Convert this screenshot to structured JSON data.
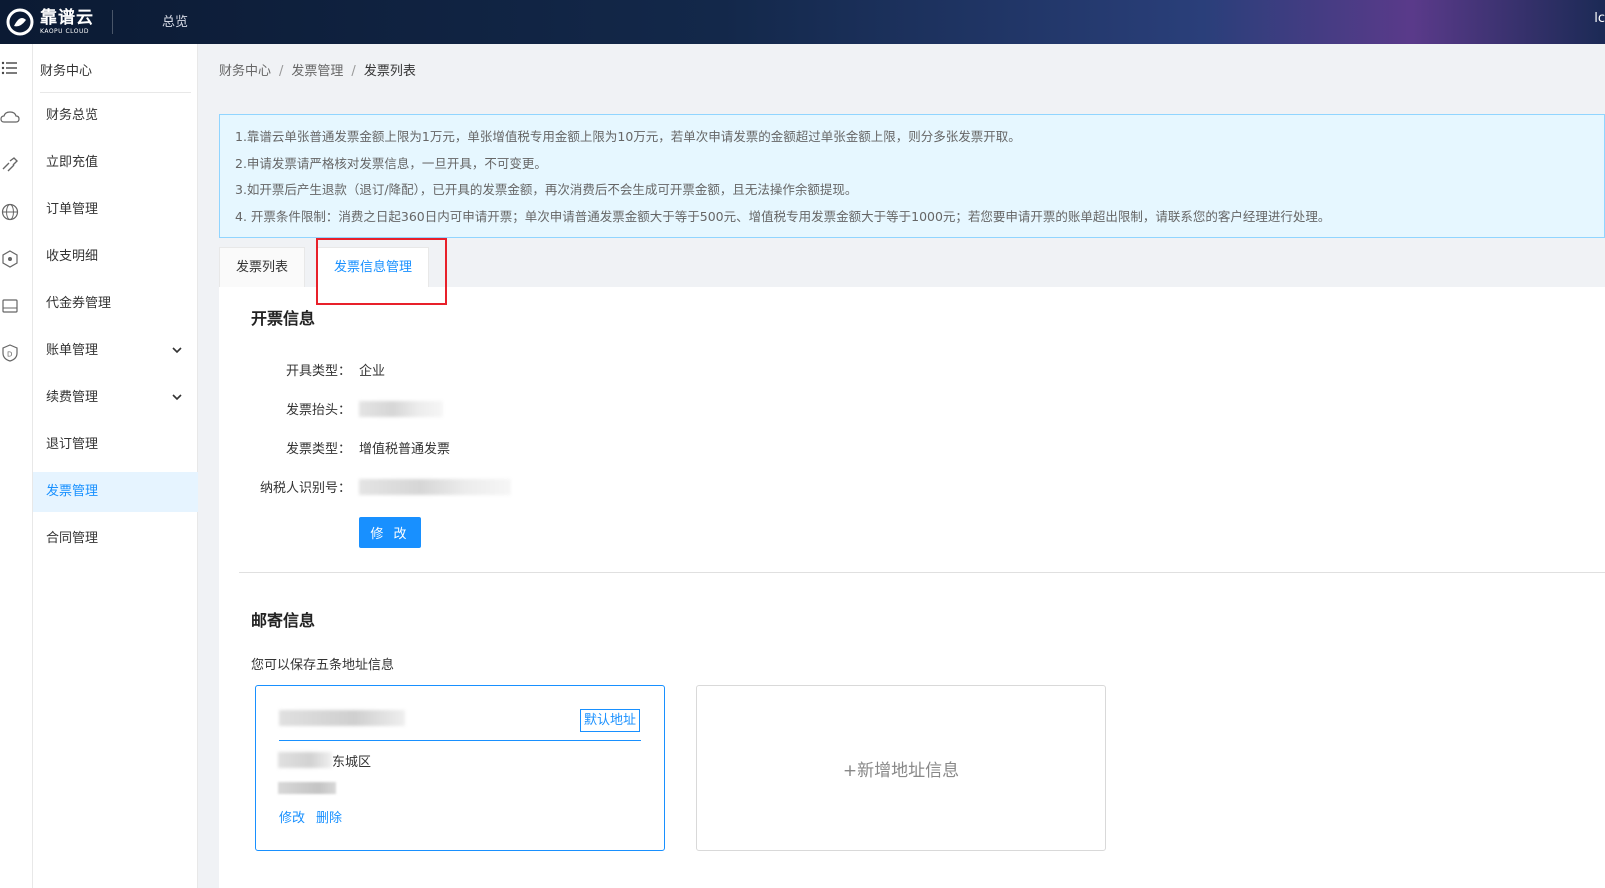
{
  "header": {
    "logo_cn": "靠谱云",
    "logo_en": "KAOPU CLOUD",
    "nav_overview": "总览",
    "right_text": "lc"
  },
  "sidebar": {
    "title": "财务中心",
    "items": [
      {
        "label": "财务总览"
      },
      {
        "label": "立即充值"
      },
      {
        "label": "订单管理"
      },
      {
        "label": "收支明细"
      },
      {
        "label": "代金券管理"
      },
      {
        "label": "账单管理",
        "expandable": true
      },
      {
        "label": "续费管理",
        "expandable": true
      },
      {
        "label": "退订管理"
      },
      {
        "label": "发票管理",
        "active": true
      },
      {
        "label": "合同管理"
      }
    ]
  },
  "breadcrumb": [
    "财务中心",
    "发票管理",
    "发票列表"
  ],
  "notice": [
    "1.靠谱云单张普通发票金额上限为1万元，单张增值税专用金额上限为10万元，若单次申请发票的金额超过单张金额上限，则分多张发票开取。",
    "2.申请发票请严格核对发票信息，一旦开具，不可变更。",
    "3.如开票后产生退款（退订/降配），已开具的发票金额，再次消费后不会生成可开票金额，且无法操作余额提现。",
    "4. 开票条件限制：消费之日起360日内可申请开票；单次申请普通发票金额大于等于500元、增值税专用发票金额大于等于1000元；若您要申请开票的账单超出限制，请联系您的客户经理进行处理。"
  ],
  "tabs": [
    {
      "label": "发票列表"
    },
    {
      "label": "发票信息管理",
      "active": true
    }
  ],
  "invoice_info": {
    "title": "开票信息",
    "fields": [
      {
        "label": "开具类型：",
        "value": "企业"
      },
      {
        "label": "发票抬头：",
        "value": ""
      },
      {
        "label": "发票类型：",
        "value": "增值税普通发票"
      },
      {
        "label": "纳税人识别号：",
        "value": ""
      }
    ],
    "edit_button": "修 改"
  },
  "mailing": {
    "title": "邮寄信息",
    "hint": "您可以保存五条地址信息",
    "card": {
      "default_tag": "默认地址",
      "region": "东城区",
      "edit_link": "修改",
      "delete_link": "删除"
    },
    "add_label": "+新增地址信息"
  },
  "colors": {
    "primary": "#1890ff",
    "highlight": "#e8202a",
    "notice_bg": "#e6f7ff"
  }
}
